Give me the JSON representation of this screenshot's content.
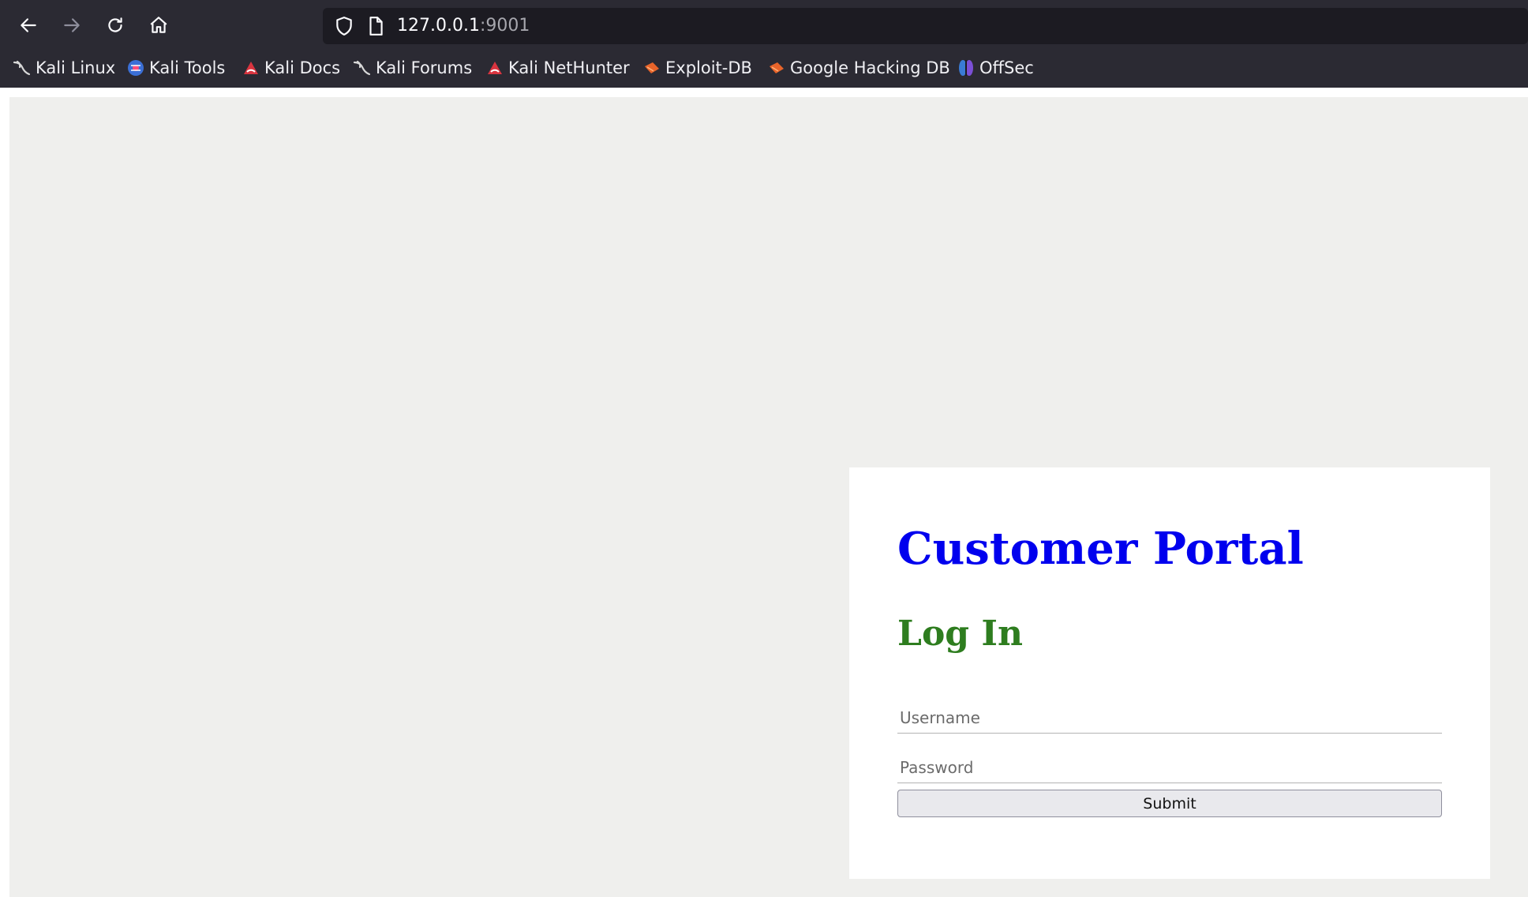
{
  "browser": {
    "url_host": "127.0.0.1",
    "url_port": ":9001",
    "icons": [
      "back-icon",
      "forward-icon",
      "reload-icon",
      "home-icon",
      "shield-icon",
      "page-icon"
    ],
    "bookmarks": [
      {
        "label": "Kali Linux",
        "icon": "kali-dragon-icon"
      },
      {
        "label": "Kali Tools",
        "icon": "kali-tools-icon"
      },
      {
        "label": "Kali Docs",
        "icon": "kali-docs-icon"
      },
      {
        "label": "Kali Forums",
        "icon": "kali-dragon-icon"
      },
      {
        "label": "Kali NetHunter",
        "icon": "kali-nethunter-icon"
      },
      {
        "label": "Exploit-DB",
        "icon": "exploit-db-icon"
      },
      {
        "label": "Google Hacking DB",
        "icon": "exploit-db-icon"
      },
      {
        "label": "OffSec",
        "icon": "offsec-icon"
      }
    ]
  },
  "page": {
    "title": "Customer Portal",
    "subtitle": "Log In",
    "username_placeholder": "Username",
    "password_placeholder": "Password",
    "submit_label": "Submit"
  },
  "colors": {
    "chrome_bg": "#2b2a33",
    "urlbar_bg": "#1c1b22",
    "page_bg": "#efefed",
    "title_color": "#0000ee",
    "subtitle_color": "#2e7d1f"
  }
}
